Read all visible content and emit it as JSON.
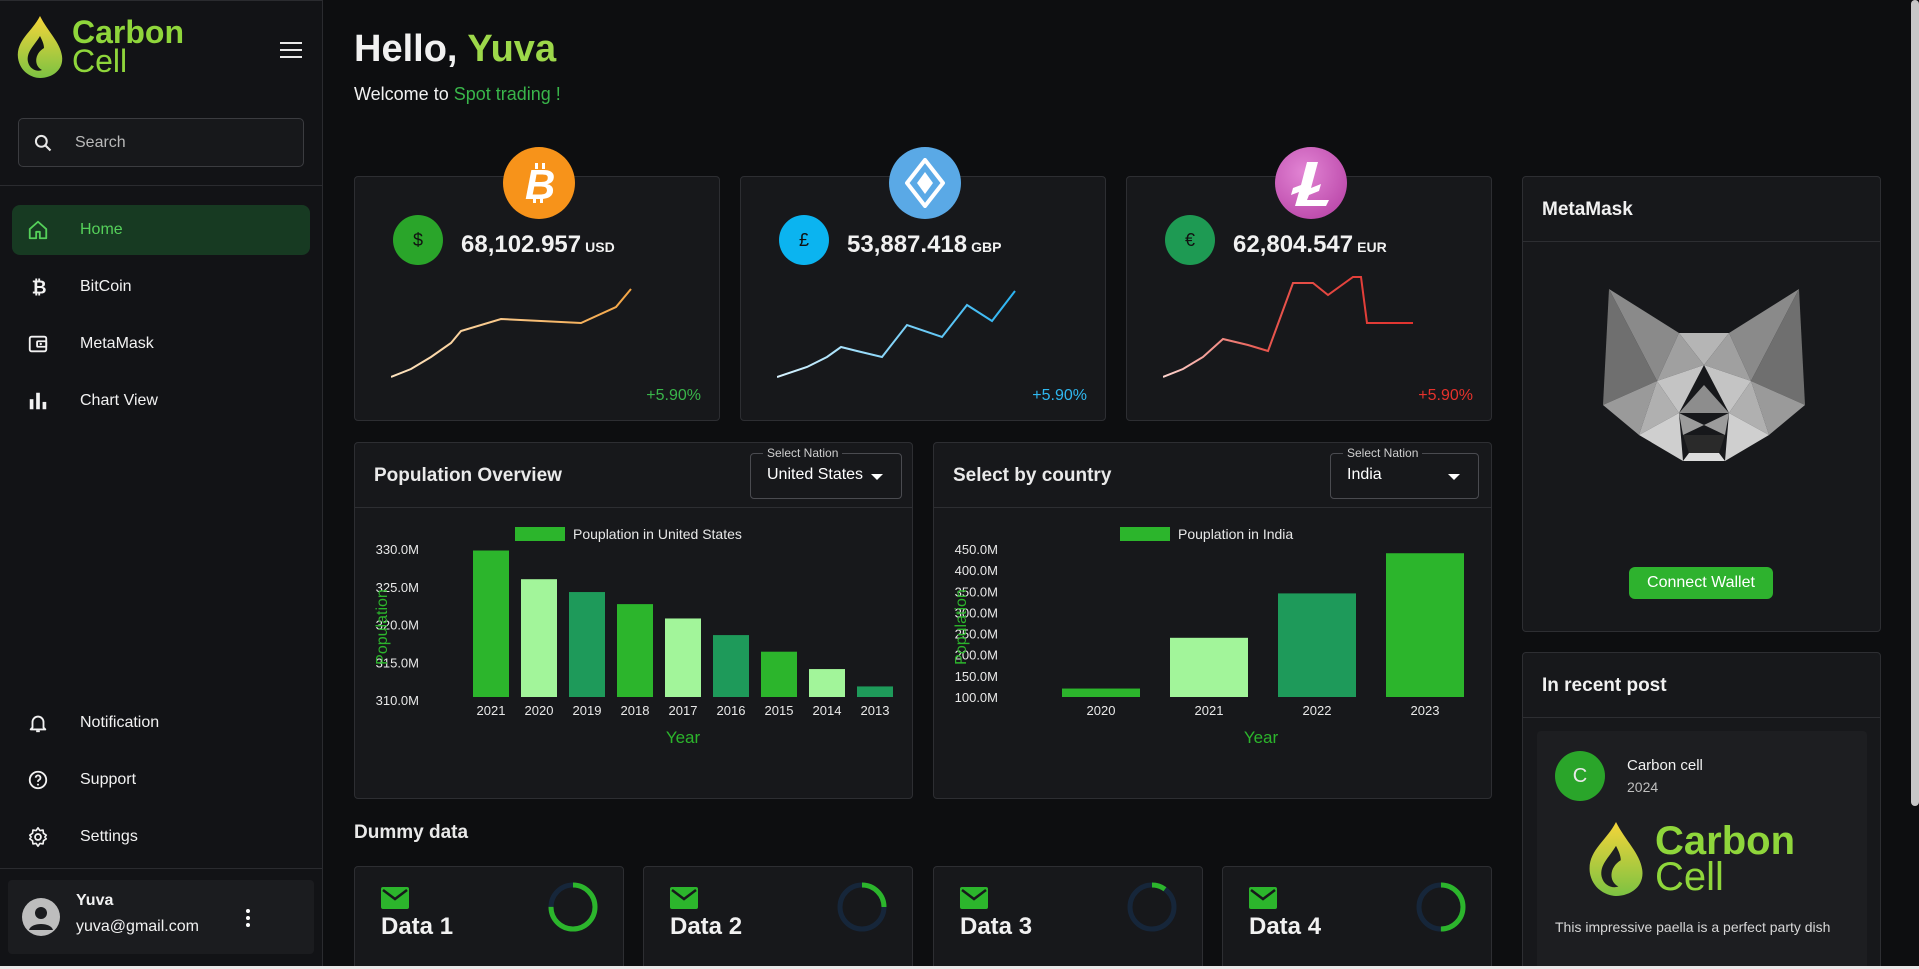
{
  "app": {
    "logo_line1": "Carbon",
    "logo_line2": "Cell"
  },
  "search": {
    "placeholder": "Search"
  },
  "nav": {
    "items": [
      {
        "label": "Home",
        "icon": "home-icon",
        "active": true
      },
      {
        "label": "BitCoin",
        "icon": "bitcoin-icon"
      },
      {
        "label": "MetaMask",
        "icon": "wallet-icon"
      },
      {
        "label": "Chart View",
        "icon": "bar-chart-icon"
      }
    ],
    "bottom": [
      {
        "label": "Notification",
        "icon": "bell-icon"
      },
      {
        "label": "Support",
        "icon": "help-icon"
      },
      {
        "label": "Settings",
        "icon": "gear-icon"
      }
    ]
  },
  "user": {
    "name": "Yuva",
    "email": "yuva@gmail.com"
  },
  "greeting": {
    "hello": "Hello,",
    "name": "Yuva",
    "welcome": "Welcome to",
    "highlight": "Spot trading !"
  },
  "coins": [
    {
      "symbol": "$",
      "price": "68,102.957",
      "currency": "USD",
      "change": "+5.90%",
      "coin_icon": "bitcoin-icon",
      "color": "#f7931a",
      "currency_color": "#2aa52a",
      "line_color": "#f4b25a",
      "change_color": "#39b54a"
    },
    {
      "symbol": "£",
      "price": "53,887.418",
      "currency": "GBP",
      "change": "+5.90%",
      "coin_icon": "ethereum-icon",
      "color": "#5aa9e6",
      "currency_color": "#0bb4f0",
      "line_color": "#3fb8f0",
      "change_color": "#2fb8f0"
    },
    {
      "symbol": "€",
      "price": "62,804.547",
      "currency": "EUR",
      "change": "+5.90%",
      "coin_icon": "litecoin-icon",
      "color": "#c94fb4",
      "currency_color": "#1e9a53",
      "line_color": "#e0322e",
      "change_color": "#e5322c"
    }
  ],
  "population": {
    "title": "Population Overview",
    "select_label": "Select Nation",
    "select_value": "United States"
  },
  "country": {
    "title": "Select by country",
    "select_label": "Select Nation",
    "select_value": "India"
  },
  "chart_data": [
    {
      "type": "bar",
      "legend": "Pouplation in United States",
      "categories": [
        "2021",
        "2020",
        "2019",
        "2018",
        "2017",
        "2016",
        "2015",
        "2014",
        "2013"
      ],
      "values": [
        329.8,
        326.0,
        324.3,
        322.7,
        320.8,
        318.6,
        316.4,
        314.1,
        311.8
      ],
      "yticks": [
        "330.0M",
        "325.0M",
        "320.0M",
        "315.0M",
        "310.0M"
      ],
      "ylim": [
        310.4,
        330.0
      ],
      "xlabel": "Year",
      "ylabel": "Population",
      "colors": [
        "#2cb52c",
        "#a2f59a",
        "#1e9a5a"
      ]
    },
    {
      "type": "bar",
      "legend": "Pouplation in India",
      "categories": [
        "2020",
        "2021",
        "2022",
        "2023"
      ],
      "values": [
        120,
        240,
        345,
        440
      ],
      "yticks": [
        "450.0M",
        "400.0M",
        "350.0M",
        "300.0M",
        "250.0M",
        "200.0M",
        "150.0M",
        "100.0M"
      ],
      "ylim": [
        100,
        450
      ],
      "xlabel": "Year",
      "ylabel": "Population",
      "colors": [
        "#2cb52c",
        "#a2f59a",
        "#1e9a5a"
      ]
    }
  ],
  "metamask": {
    "title": "MetaMask",
    "button": "Connect Wallet"
  },
  "recent": {
    "title": "In recent post",
    "avatar_letter": "C",
    "author": "Carbon cell",
    "year": "2024",
    "logo_line1": "Carbon",
    "logo_line2": "Cell",
    "text": "This impressive paella is a perfect party dish"
  },
  "dummy": {
    "title": "Dummy data",
    "cards": [
      {
        "label": "Data 1",
        "progress": 0.75,
        "color": "#2cb52c"
      },
      {
        "label": "Data 2",
        "progress": 0.25,
        "color": "#2cb52c"
      },
      {
        "label": "Data 3",
        "progress": 0.1,
        "color": "#2cb52c"
      },
      {
        "label": "Data 4",
        "progress": 0.5,
        "color": "#2cb52c"
      }
    ]
  }
}
